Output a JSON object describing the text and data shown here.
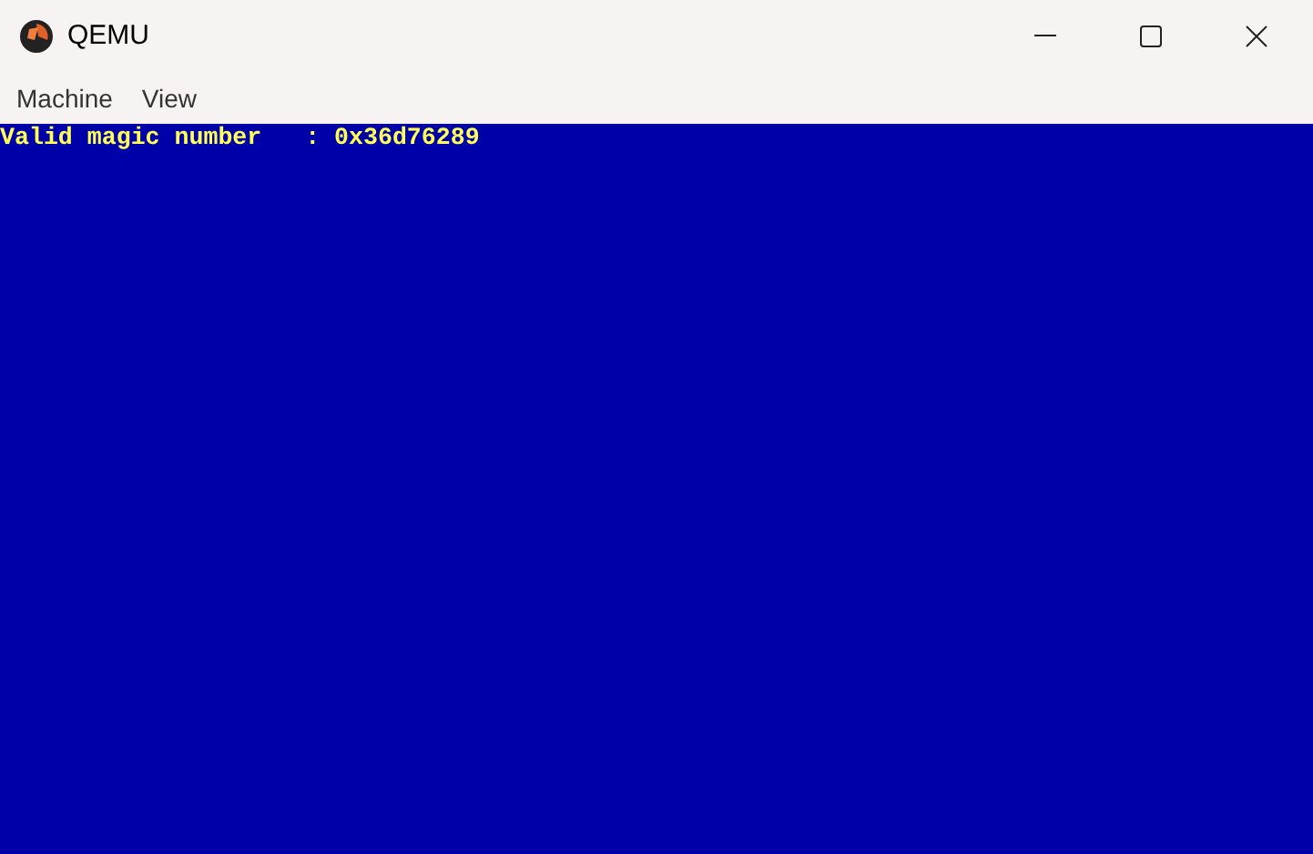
{
  "window": {
    "title": "QEMU"
  },
  "menu": [
    "Machine",
    "View"
  ],
  "screen": {
    "lines": [
      "Valid magic number   : 0x36d76289"
    ]
  }
}
